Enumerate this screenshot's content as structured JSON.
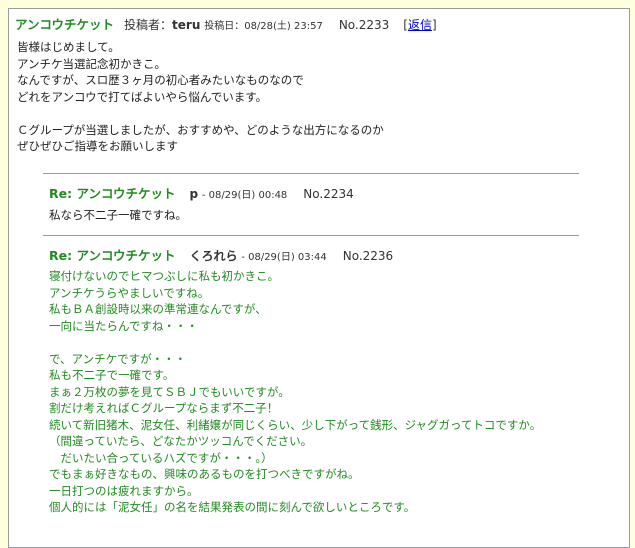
{
  "post": {
    "title": "アンコウチケット",
    "author_label": "投稿者：",
    "author": "teru",
    "date_label": "投稿日：",
    "date": "08/28(土) 23:57",
    "number": "No.2233",
    "reply_open": "[",
    "reply_link": "返信",
    "reply_close": "]",
    "lines": [
      "皆様はじめまして。",
      "アンチケ当選記念初かきこ。",
      "なんですが、スロ歴３ヶ月の初心者みたいなものなので",
      "どれをアンコウで打てばよいやら悩んでいます。",
      "",
      "Ｃグループが当選しましたが、おすすめや、どのような出方になるのか",
      "ぜひぜひご指導をお願いします"
    ]
  },
  "replies": [
    {
      "title": "Re: アンコウチケット",
      "author": "p",
      "date": "- 08/29(日) 00:48",
      "number": "No.2234",
      "lines": [
        "私なら不二子一確ですね。"
      ]
    },
    {
      "title": "Re: アンコウチケット",
      "author": "くろれら",
      "date": "- 08/29(日) 03:44",
      "number": "No.2236",
      "lines": [
        "寝付けないのでヒマつぶしに私も初かきこ。",
        "アンチケうらやましいですね。",
        "私もＢＡ創設時以来の準常連なんですが、",
        "一向に当たらんですね・・・",
        "",
        "で、アンチケですが・・・",
        "私も不二子で一確です。",
        "まぁ２万枚の夢を見てＳＢＪでもいいですが。",
        "割だけ考えればＣグループならまず不二子！",
        "続いて新旧猪木、泥女任、利緒嬢が同じくらい、少し下がって銭形、ジャグガってトコですか。",
        "（間違っていたら、どなたかツッコんでください。",
        "　だいたい合っているハズですが・・・。）",
        "でもまぁ好きなもの、興味のあるものを打つべきですがね。",
        "一日打つのは疲れますから。",
        "個人的には「泥女任」の名を結果発表の間に刻んで欲しいところです。"
      ]
    }
  ]
}
